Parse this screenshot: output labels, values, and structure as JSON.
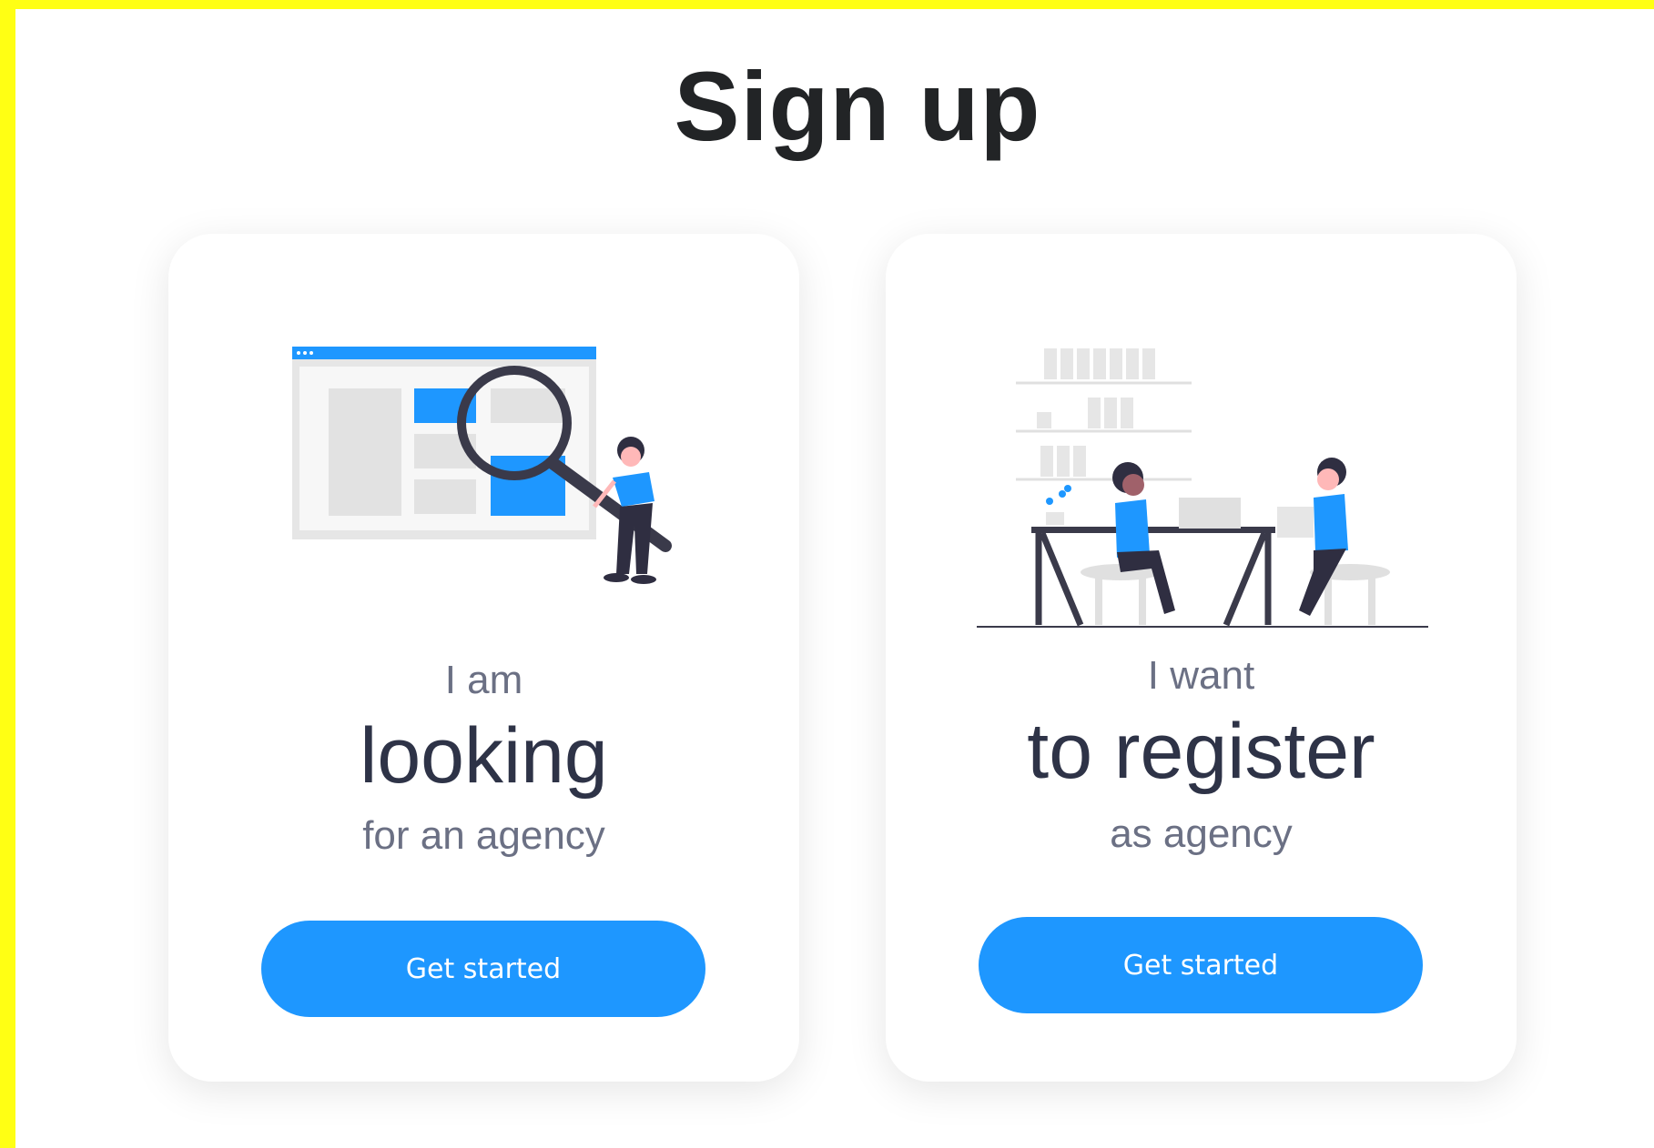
{
  "page": {
    "title": "Sign up"
  },
  "colors": {
    "accent": "#1e97ff",
    "dark": "#2e3347",
    "muted": "#6b7084",
    "frame": "#ffff14"
  },
  "cards": [
    {
      "illustration": "search-person-illustration",
      "line1": "I am",
      "line2": "looking",
      "line3": "for an agency",
      "button": "Get started"
    },
    {
      "illustration": "team-desk-illustration",
      "line1": "I want",
      "line2": "to register",
      "line3": "as agency",
      "button": "Get started"
    }
  ]
}
